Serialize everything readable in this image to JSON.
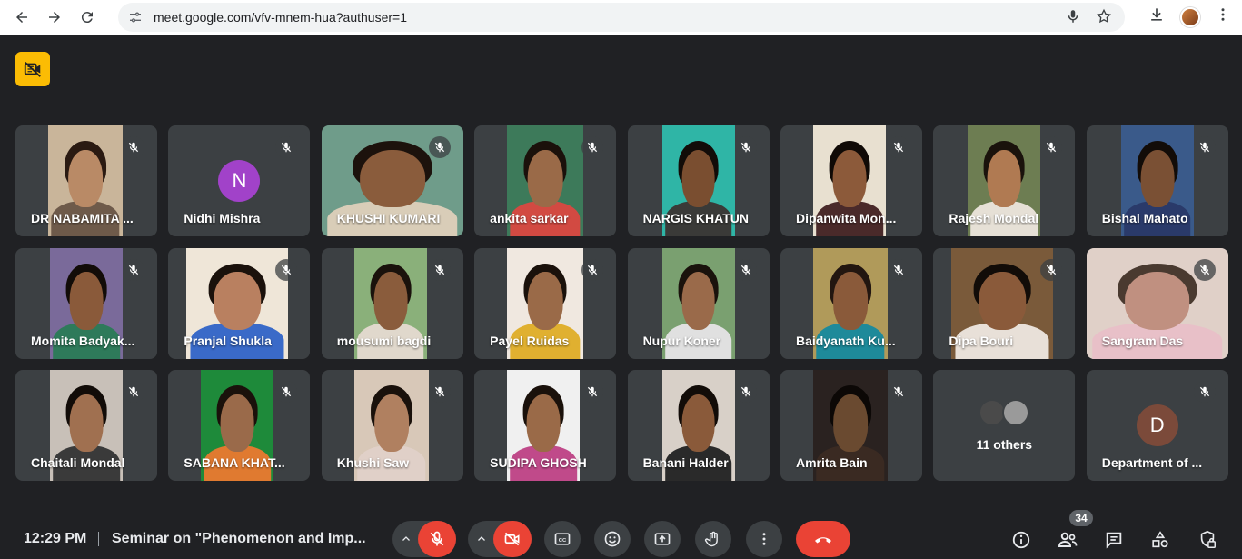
{
  "browser": {
    "url": "meet.google.com/vfv-mnem-hua?authuser=1"
  },
  "colors": {
    "accent_warning": "#fbbc04",
    "end_call": "#ea4335",
    "tile_bg": "#3c4043",
    "page_bg": "#202124"
  },
  "participants": [
    {
      "name": "DR NABAMITA ...",
      "type": "video"
    },
    {
      "name": "Nidhi Mishra",
      "type": "avatar",
      "initial": "N",
      "avatar_color": "#a142c9"
    },
    {
      "name": "KHUSHI KUMARI",
      "type": "video"
    },
    {
      "name": "ankita sarkar",
      "type": "video"
    },
    {
      "name": "NARGIS KHATUN",
      "type": "video"
    },
    {
      "name": "Dipanwita Mon...",
      "type": "video"
    },
    {
      "name": "Rajesh Mondal",
      "type": "video"
    },
    {
      "name": "Bishal Mahato",
      "type": "video"
    },
    {
      "name": "Momita Badyak...",
      "type": "video"
    },
    {
      "name": "Pranjal Shukla",
      "type": "video"
    },
    {
      "name": "mousumi bagdi",
      "type": "video"
    },
    {
      "name": "Payel Ruidas",
      "type": "video"
    },
    {
      "name": "Nupur Koner",
      "type": "video"
    },
    {
      "name": "Baidyanath Ku...",
      "type": "video"
    },
    {
      "name": "Dipa Bouri",
      "type": "video"
    },
    {
      "name": "Sangram Das",
      "type": "video"
    },
    {
      "name": "Chaitali Mondal",
      "type": "video"
    },
    {
      "name": "SABANA KHAT...",
      "type": "video"
    },
    {
      "name": "Khushi Saw",
      "type": "video"
    },
    {
      "name": "SUDIPA GHOSH",
      "type": "video"
    },
    {
      "name": "Banani Halder",
      "type": "video"
    },
    {
      "name": "Amrita Bain",
      "type": "video"
    },
    {
      "name": "11 others",
      "type": "others"
    },
    {
      "name": "Department of ...",
      "type": "avatar",
      "initial": "D",
      "avatar_color": "#7b4a3a"
    }
  ],
  "meeting": {
    "time": "12:29 PM",
    "title": "Seminar on \"Phenomenon and Imp...",
    "participant_count": "34"
  },
  "icons": {
    "nav": [
      "back-arrow-icon",
      "forward-arrow-icon",
      "reload-icon"
    ],
    "omnibox": [
      "site-info-tune-icon",
      "mic-icon",
      "star-icon"
    ],
    "toolbar": [
      "download-icon",
      "profile-avatar",
      "more-vert-icon"
    ],
    "controls": [
      "mic-off-icon",
      "camera-off-icon",
      "captions-icon",
      "emoji-icon",
      "present-icon",
      "raise-hand-icon",
      "more-options-icon",
      "end-call-icon"
    ],
    "right": [
      "info-icon",
      "people-icon",
      "chat-icon",
      "activities-icon",
      "host-controls-icon"
    ]
  }
}
